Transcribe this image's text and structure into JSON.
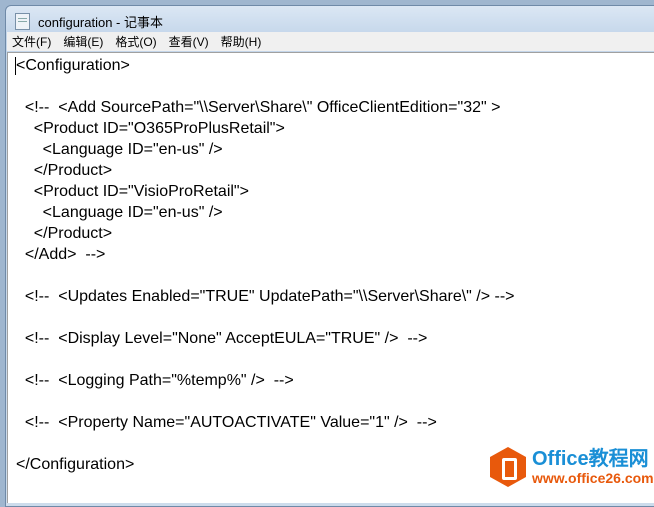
{
  "window": {
    "title": "configuration - 记事本"
  },
  "menu": [
    "文件(F)",
    "编辑(E)",
    "格式(O)",
    "查看(V)",
    "帮助(H)"
  ],
  "content": "<Configuration>\n\n  <!--  <Add SourcePath=\"\\\\Server\\Share\\\" OfficeClientEdition=\"32\" >\n    <Product ID=\"O365ProPlusRetail\">\n      <Language ID=\"en-us\" />\n    </Product>\n    <Product ID=\"VisioProRetail\">\n      <Language ID=\"en-us\" />\n    </Product>\n  </Add>  -->\n\n  <!--  <Updates Enabled=\"TRUE\" UpdatePath=\"\\\\Server\\Share\\\" /> -->\n\n  <!--  <Display Level=\"None\" AcceptEULA=\"TRUE\" />  -->\n\n  <!--  <Logging Path=\"%temp%\" />  -->\n\n  <!--  <Property Name=\"AUTOACTIVATE\" Value=\"1\" />  -->\n\n</Configuration>",
  "watermark": {
    "name": "Office教程网",
    "url": "www.office26.com"
  }
}
